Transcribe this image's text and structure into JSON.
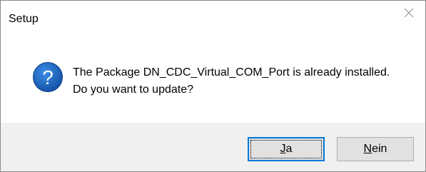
{
  "window": {
    "title": "Setup",
    "close_icon": "close-icon"
  },
  "dialog": {
    "icon": "question-icon",
    "icon_color": "#1d5fb8",
    "message_line1": "The Package DN_CDC_Virtual_COM_Port is already installed.",
    "message_line2": "Do you want to update?"
  },
  "buttons": {
    "yes": {
      "mnemonic": "J",
      "rest": "a"
    },
    "no": {
      "mnemonic": "N",
      "rest": "ein"
    }
  }
}
